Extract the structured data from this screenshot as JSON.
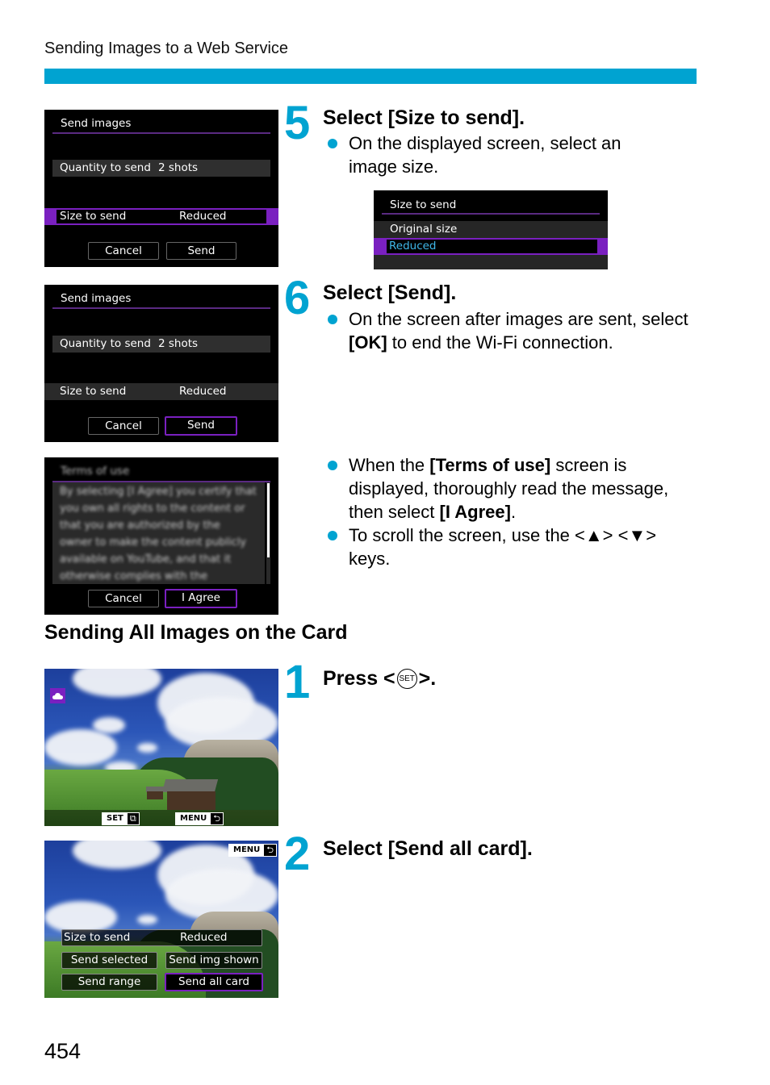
{
  "page": {
    "running_head": "Sending Images to a Web Service",
    "page_number": "454",
    "accent_color": "#00a3d1",
    "selection_color": "#7a20c0"
  },
  "screens": {
    "send_images_1": {
      "title": "Send images",
      "quantity_label": "Quantity to send",
      "quantity_value": "2 shots",
      "size_label": "Size to send",
      "size_value": "Reduced",
      "cancel": "Cancel",
      "send": "Send",
      "selected": "size_to_send"
    },
    "size_to_send": {
      "title": "Size to send",
      "options": [
        "Original size",
        "Reduced"
      ],
      "selected": "Reduced"
    },
    "send_images_2": {
      "title": "Send images",
      "quantity_label": "Quantity to send",
      "quantity_value": "2 shots",
      "size_label": "Size to send",
      "size_value": "Reduced",
      "cancel": "Cancel",
      "send": "Send",
      "selected": "send"
    },
    "terms_of_use": {
      "title": "Terms of use",
      "body_lines": [
        "By selecting [I Agree] you certify that",
        "you own all rights to the content or",
        "that you are authorized by the",
        "owner to make the content publicly",
        "available on YouTube, and that it",
        "otherwise complies with the"
      ],
      "cancel": "Cancel",
      "agree": "I Agree",
      "selected": "agree"
    },
    "playback": {
      "set_key": "SET",
      "menu_key": "MENU"
    },
    "send_options": {
      "menu_key": "MENU",
      "size_label": "Size to send",
      "size_value": "Reduced",
      "buttons": [
        "Send selected",
        "Send img shown",
        "Send range",
        "Send all card"
      ],
      "selected": "Send all card"
    }
  },
  "steps": {
    "s5": {
      "number": "5",
      "title": "Select [Size to send].",
      "bullets": [
        "On the displayed screen, select an image size."
      ]
    },
    "s6": {
      "number": "6",
      "title": "Select [Send].",
      "bullet_pre": "On the screen after images are sent, select ",
      "bullet_bold": "[OK]",
      "bullet_post": " to end the Wi-Fi connection."
    },
    "terms_notes": {
      "b1_pre": "When the ",
      "b1_bold1": "[Terms of use]",
      "b1_mid": " screen is displayed, thoroughly read the message, then select ",
      "b1_bold2": "[I Agree]",
      "b1_post": ".",
      "b2": "To scroll the screen, use the <▲> <▼> keys."
    },
    "section_heading": "Sending All Images on the Card",
    "a1": {
      "number": "1",
      "title_pre": "Press <",
      "set_glyph": "SET",
      "title_post": ">."
    },
    "a2": {
      "number": "2",
      "title": "Select [Send all card]."
    }
  }
}
